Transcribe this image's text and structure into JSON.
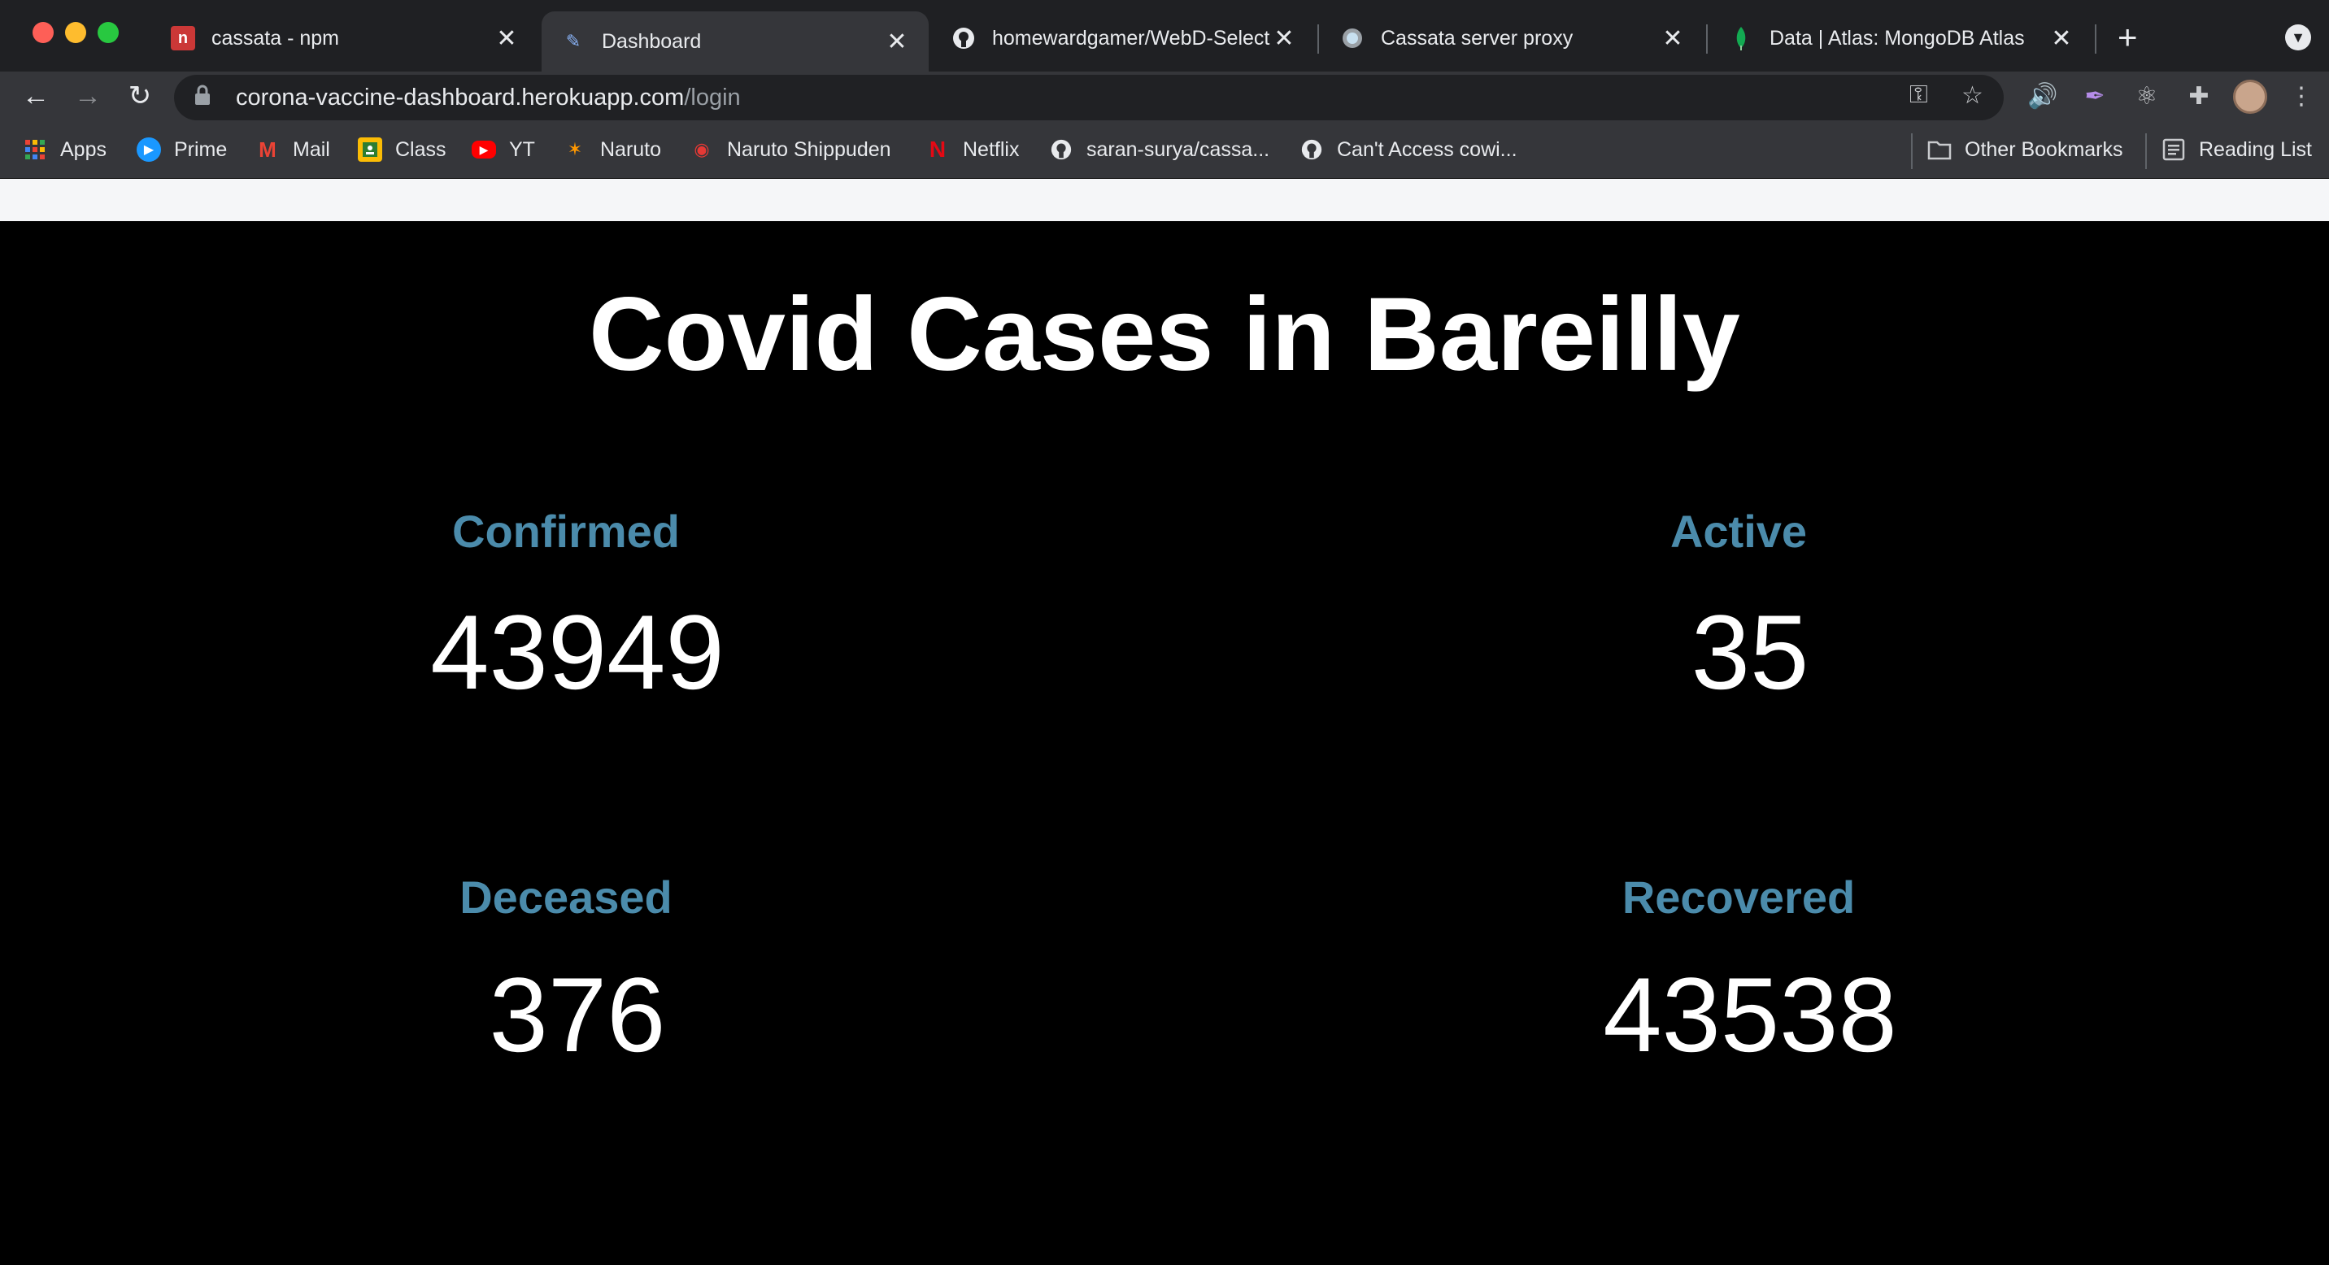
{
  "browser": {
    "tabs": [
      {
        "title": "cassata - npm",
        "favicon": "npm-icon"
      },
      {
        "title": "Dashboard",
        "favicon": "pen-icon",
        "active": true
      },
      {
        "title": "homewardgamer/WebD-Select",
        "favicon": "github-icon"
      },
      {
        "title": "Cassata server proxy",
        "favicon": "globe-icon"
      },
      {
        "title": "Data | Atlas: MongoDB Atlas",
        "favicon": "mongodb-leaf-icon"
      }
    ],
    "url_host": "corona-vaccine-dashboard.herokuapp.com",
    "url_path": "/login",
    "bookmarks": [
      {
        "label": "Apps"
      },
      {
        "label": "Prime"
      },
      {
        "label": "Mail"
      },
      {
        "label": "Class"
      },
      {
        "label": "YT"
      },
      {
        "label": "Naruto"
      },
      {
        "label": "Naruto Shippuden"
      },
      {
        "label": "Netflix"
      },
      {
        "label": "saran-surya/cassa..."
      },
      {
        "label": "Can't Access cowi..."
      }
    ],
    "other_bookmarks": "Other Bookmarks",
    "reading_list": "Reading List"
  },
  "dashboard": {
    "title": "Covid Cases in Bareilly",
    "stats": {
      "confirmed": {
        "label": "Confirmed",
        "value": "43949"
      },
      "active": {
        "label": "Active",
        "value": "35"
      },
      "deceased": {
        "label": "Deceased",
        "value": "376"
      },
      "recovered": {
        "label": "Recovered",
        "value": "43538"
      }
    }
  },
  "colors": {
    "label_blue": "#4b8bab",
    "background": "#000000",
    "tab_bar": "#1f2023",
    "toolbar": "#35363a"
  }
}
